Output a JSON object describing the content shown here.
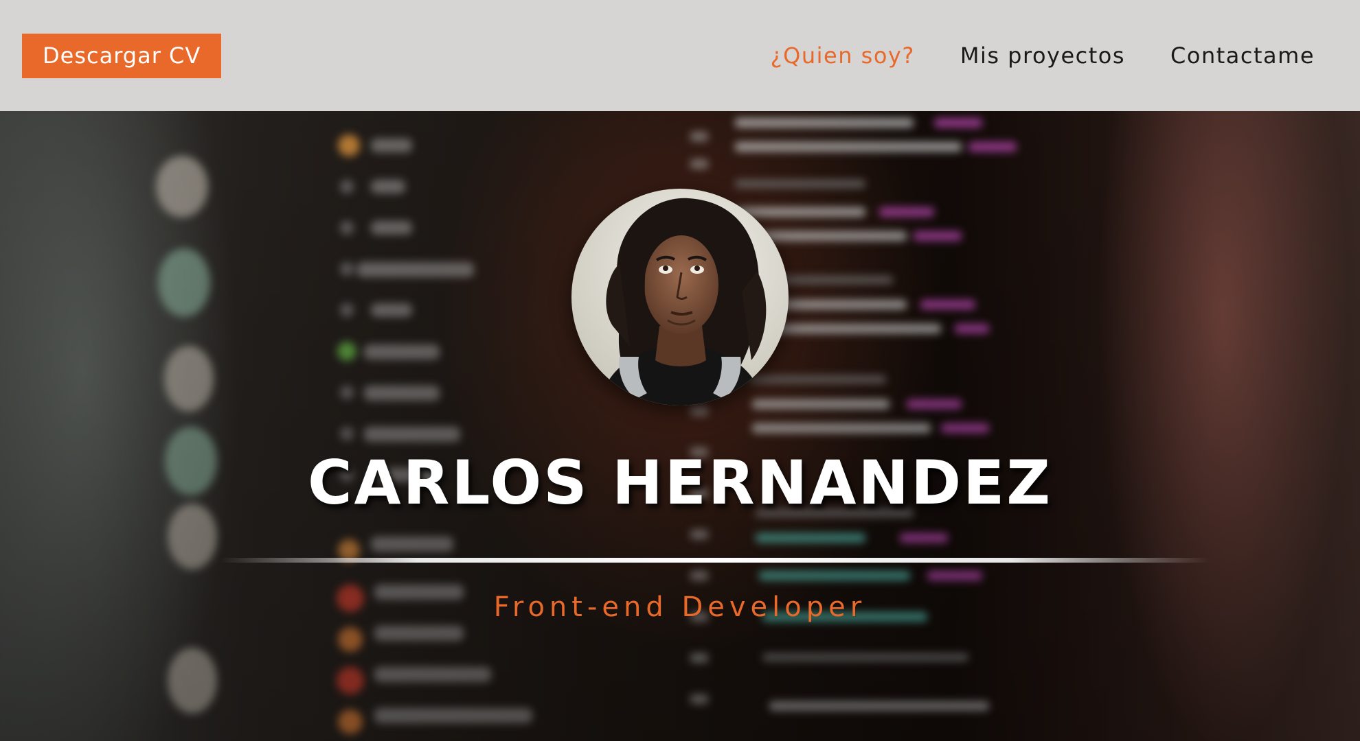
{
  "navbar": {
    "cv_button": "Descargar CV",
    "links": [
      {
        "label": "¿Quien soy?",
        "active": true
      },
      {
        "label": "Mis proyectos",
        "active": false
      },
      {
        "label": "Contactame",
        "active": false
      }
    ]
  },
  "hero": {
    "name": "CARLOS HERNANDEZ",
    "role": "Front-end Developer",
    "avatar_icon": "profile-photo"
  },
  "colors": {
    "accent": "#e8692a",
    "navbar_bg": "#d6d5d4",
    "nav_text": "#1a1a1a",
    "name_text": "#ffffff"
  }
}
